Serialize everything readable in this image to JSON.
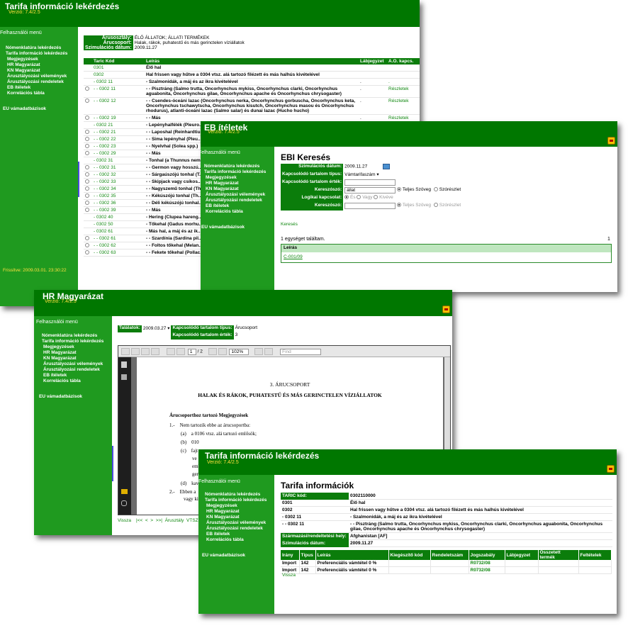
{
  "menu": {
    "title": "Felhasználói menü",
    "items": [
      "Nómenklatúra lekérdezés",
      "Tarifa információ lekérdezés",
      "Megjegyzések",
      "HR Magyarázat",
      "KN Magyarázat",
      "Árusztályozási vélemények",
      "Árusztályozási rendeletek",
      "EB ítéletek",
      "Korrelációs tábla"
    ],
    "eu": "EU vámadatbázisok"
  },
  "w1": {
    "title": "Tarifa információ lekérdezés",
    "version": "Verzió: 7.4/2.5",
    "updated": "Frissítve:  2009.03.01. 23:30:22",
    "info": [
      [
        "Árusosztály:",
        "ÉLŐ ÁLLATOK; ÁLLATI TERMÉKEK"
      ],
      [
        "Árucsoport:",
        "Halak, rákok, puhatestű és más gerinctelen víziállatok"
      ],
      [
        "Szimulációs dátum:",
        "2009.11.27"
      ]
    ],
    "headers": [
      "Taric Kód",
      "Leírás",
      "Lábjegyzet",
      "A.O. kapcs."
    ],
    "rows": [
      {
        "r": 0,
        "c": "0301",
        "d": "Élő hal",
        "f": "",
        "a": ""
      },
      {
        "r": 0,
        "c": "0302",
        "d": "Hal frissen vagy hűtve a 0304 vtsz. alá tartozó filézett és más halhús kivételével",
        "f": "",
        "a": ""
      },
      {
        "r": 0,
        "c": "- 0302 11",
        "d": "- Szalmonidák, a máj és az ikra kivételével",
        "f": ".",
        "a": "."
      },
      {
        "r": 1,
        "c": "- - 0302 11",
        "d": "- - Pisztráng (Salmo trutta, Oncorhynchus mykiss, Oncorhynchus clarki, Oncorhynchus aguabonita, Oncorhynchus gilae, Oncorhynchus apache és Oncorhynchus chrysogaster)",
        "f": ".",
        "a": "Részletek"
      },
      {
        "r": 1,
        "c": "- - 0302 12",
        "d": "- - Csendes-óceáni lazac (Oncorhynchus nerka, Oncorhynchus gorbuscha, Oncorhynchus keta, Oncorhynchus tschawytscha, Oncorhynchus kisutch, Oncorhynchus masou és Oncorhynchus rhodurus), atlanti-óceáni lazac (Salmo salar) és dunai lazac (Hucho hucho)",
        "f": ".",
        "a": "Részletek"
      },
      {
        "r": 1,
        "c": "- - 0302 19",
        "d": "- - Más",
        "f": ".",
        "a": "Részletek"
      },
      {
        "r": 0,
        "c": "- 0302 21",
        "d": "- Lepényhalfélék (Pleuro... Citharidae), a máj és az...",
        "f": "",
        "a": ""
      },
      {
        "r": 1,
        "c": "- - 0302 21",
        "d": "- - Laposhal (Reinhardtiu...",
        "f": "",
        "a": ""
      },
      {
        "r": 1,
        "c": "- - 0302 22",
        "d": "- - Sima lepényhal (Pleu...",
        "f": "",
        "a": ""
      },
      {
        "r": 1,
        "c": "- - 0302 23",
        "d": "- - Nyelvhal (Solea spp.)",
        "f": "",
        "a": ""
      },
      {
        "r": 1,
        "c": "- - 0302 29",
        "d": "- - Más",
        "f": "",
        "a": ""
      },
      {
        "r": 0,
        "c": "- 0302 31",
        "d": "- Tonhal (a Thunnus nem... máj és az ikra kivételév...",
        "f": "",
        "a": ""
      },
      {
        "r": 1,
        "c": "- - 0302 31",
        "d": "- - Germon vagy hosszú...",
        "f": "",
        "a": ""
      },
      {
        "r": 1,
        "c": "- - 0302 32",
        "d": "- - Sárgaúszójú tonhal (T...",
        "f": "",
        "a": ""
      },
      {
        "r": 1,
        "c": "- - 0302 33",
        "d": "- - Skipjack vagy csíkos...",
        "f": "",
        "a": ""
      },
      {
        "r": 1,
        "c": "- - 0302 34",
        "d": "- - Nagyszemű tonhal (Th...",
        "f": "",
        "a": ""
      },
      {
        "r": 1,
        "c": "- - 0302 35",
        "d": "- - Kékúszójú tonhal (Th...",
        "f": "",
        "a": ""
      },
      {
        "r": 1,
        "c": "- - 0302 36",
        "d": "- - Déli kékúszójú tonhal...",
        "f": "",
        "a": ""
      },
      {
        "r": 1,
        "c": "- - 0302 39",
        "d": "- - Más",
        "f": "",
        "a": ""
      },
      {
        "r": 0,
        "c": "- 0302 40",
        "d": "- Hering (Clupea hareng...",
        "f": "",
        "a": ""
      },
      {
        "r": 0,
        "c": "- 0302 50",
        "d": "- Tőkehal (Gadus morhu...",
        "f": "",
        "a": ""
      },
      {
        "r": 0,
        "c": "- 0302 61",
        "d": "- Más hal, a máj és az ik...",
        "f": "",
        "a": ""
      },
      {
        "r": 1,
        "c": "- - 0302 61",
        "d": "- - Szardínia (Sardina pil... brisling vagy spratt (spr...",
        "f": "",
        "a": ""
      },
      {
        "r": 1,
        "c": "- - 0302 62",
        "d": "- - Foltos tőkehal (Melan...",
        "f": "",
        "a": ""
      },
      {
        "r": 1,
        "c": "- - 0302 63",
        "d": "- - Fekete tőkehal (Pollac...",
        "f": "",
        "a": ""
      }
    ]
  },
  "w2": {
    "title": "EB ítéletek",
    "version": "Verzió: 7.4/2.5",
    "heading": "EBI Keresés",
    "f_date": "Szimulációs dátum:",
    "date": "2009.11.27",
    "f_type": "Kapcsolódó tartalom típus:",
    "type": "Vámtarifaszám",
    "f_val": "Kapcsolódó tartalom érték:",
    "f_kw": "Kereszószó:",
    "kw": "állat",
    "r_full": "Teljes Szöveg",
    "r_word": "Szórészlet",
    "f_logic": "Logikai kapcsolat:",
    "l_and": "És",
    "l_or": "Vagy",
    "l_not": "Kivéve",
    "f_kw2": "Kereszószó:",
    "search": "Keresés",
    "found": "1 egységet találtam.",
    "pages": "1",
    "col": "Leírás",
    "result": "C-001/09"
  },
  "w3": {
    "title": "HR Magyarázat",
    "version": "Verzió: 7.4/2.5",
    "f_hits": "Találatok:",
    "hits": "2009.03.27",
    "f_type": "Kapcsolódó tartalom típus:",
    "type": "Árucsoport",
    "f_val": "Kapcsolódó tartalom érték:",
    "val": "3",
    "page": "1",
    "pagetotal": "/ 2",
    "zoom": "102%",
    "find": "Find",
    "doc_title": "3. ÁRUCSOPORT",
    "doc_sub": "HALAK ÉS RÁKOK, PUHATESTŰ ÉS MÁS GERINCTELEN VÍZIÁLLATOK",
    "doc_sec": "Árucsoporthoz tartozó Megjegyzések",
    "doc_l1": "1.-    Nem tartozik ebbe az árucsoportba:",
    "doc_la": "(a)    a 0106 vtsz. alá tartozó emlősök;",
    "doc_lb": "(b)    010",
    "doc_lc": "(c)    fajt",
    "doc_lc2": "ve",
    "doc_lc3": "emb",
    "doc_lc4": "ger",
    "doc_ld": "(d)    kav",
    "doc_l2": "2.-    Ebben a",
    "doc_l2b": "vagy kiv",
    "back": "Vissza",
    "nav": "|<<  <  >  >>|  Árusztály  VTSZ"
  },
  "w4": {
    "title": "Tarifa információ lekérdezés",
    "version": "Verzió: 7.4/2.5",
    "heading": "Tarifa információk",
    "rows": [
      [
        "TARIC kód:",
        "0302110000"
      ],
      [
        "0301",
        "Élő hal"
      ],
      [
        "0302",
        "Hal frissen vagy hűtve a 0304 vtsz. alá tartozó filézett és más halhús kivételével"
      ],
      [
        "- 0302 11",
        "- Szalmonidák, a máj és az ikra kivételével"
      ],
      [
        "- - 0302 11",
        "- - Pisztráng (Salmo trutta, Oncorhynchus mykiss, Oncorhynchus clarki, Oncorhynchus aguabonita, Oncorhynchus gilae, Oncorhynchus apache és Oncorhynchus chrysogaster)"
      ],
      [
        "Származási/rendeltetési hely:",
        "Afghanistan [AF]"
      ],
      [
        "Szimulációs dátum:",
        "2009.11.27"
      ]
    ],
    "headers": [
      "Irány",
      "Típus",
      "Leírás",
      "Kiegészítő kód",
      "Rendeletszám",
      "Jogszabály",
      "Lábjegyzet",
      "Összetett termék",
      "Feltételek"
    ],
    "data": [
      [
        "Import",
        "142",
        "Preferenciális vámtétel 0 %",
        "",
        "",
        "R0732/08",
        "",
        "",
        ""
      ],
      [
        "Import",
        "142",
        "Preferenciális vámtétel 0 %",
        "",
        "",
        "R0732/08",
        "",
        "",
        ""
      ]
    ],
    "back": "Vissza"
  }
}
